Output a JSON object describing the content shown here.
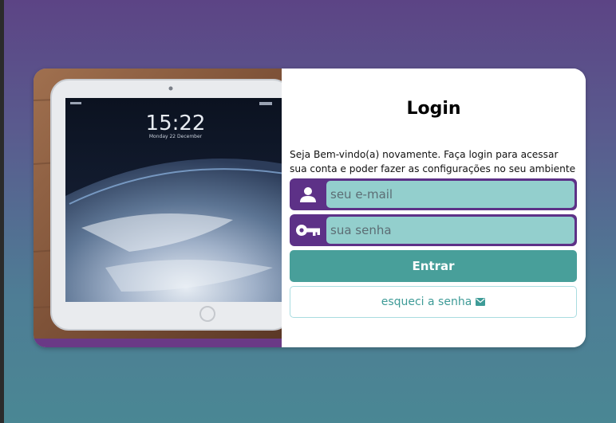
{
  "login": {
    "title": "Login",
    "welcome": "Seja Bem-vindo(a) novamente. Faça login para acessar sua conta e poder fazer as configurações no seu ambiente",
    "email_placeholder": "seu e-mail",
    "password_placeholder": "sua senha",
    "enter_label": "Entrar",
    "forgot_label": "esqueci a senha"
  },
  "device_screen": {
    "time": "15:22",
    "date": "Monday 22 December"
  },
  "icons": {
    "email": "user-icon",
    "password": "key-icon",
    "forgot": "envelope-icon"
  },
  "colors": {
    "purple": "#5d3187",
    "teal_input": "#93cfcd",
    "teal_button": "#489f9a"
  }
}
